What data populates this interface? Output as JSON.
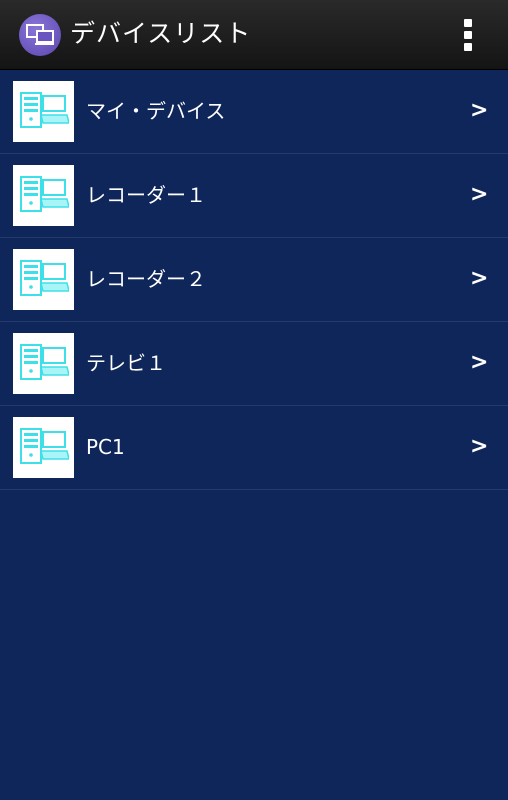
{
  "header": {
    "title": "デバイスリスト",
    "app_icon": "devices-icon",
    "menu_icon": "overflow-menu-icon"
  },
  "devices": [
    {
      "label": "マイ・デバイス",
      "icon": "computer-icon",
      "chevron": ">"
    },
    {
      "label": "レコーダー１",
      "icon": "computer-icon",
      "chevron": ">"
    },
    {
      "label": "レコーダー２",
      "icon": "computer-icon",
      "chevron": ">"
    },
    {
      "label": "テレビ１",
      "icon": "computer-icon",
      "chevron": ">"
    },
    {
      "label": "PC1",
      "icon": "computer-icon",
      "chevron": ">"
    }
  ],
  "colors": {
    "background": "#0f265a",
    "app_bar": "#1c1c1c",
    "app_icon_bg": "#6a55c0",
    "thumb_accent": "#3de0e8",
    "text": "#ffffff"
  }
}
